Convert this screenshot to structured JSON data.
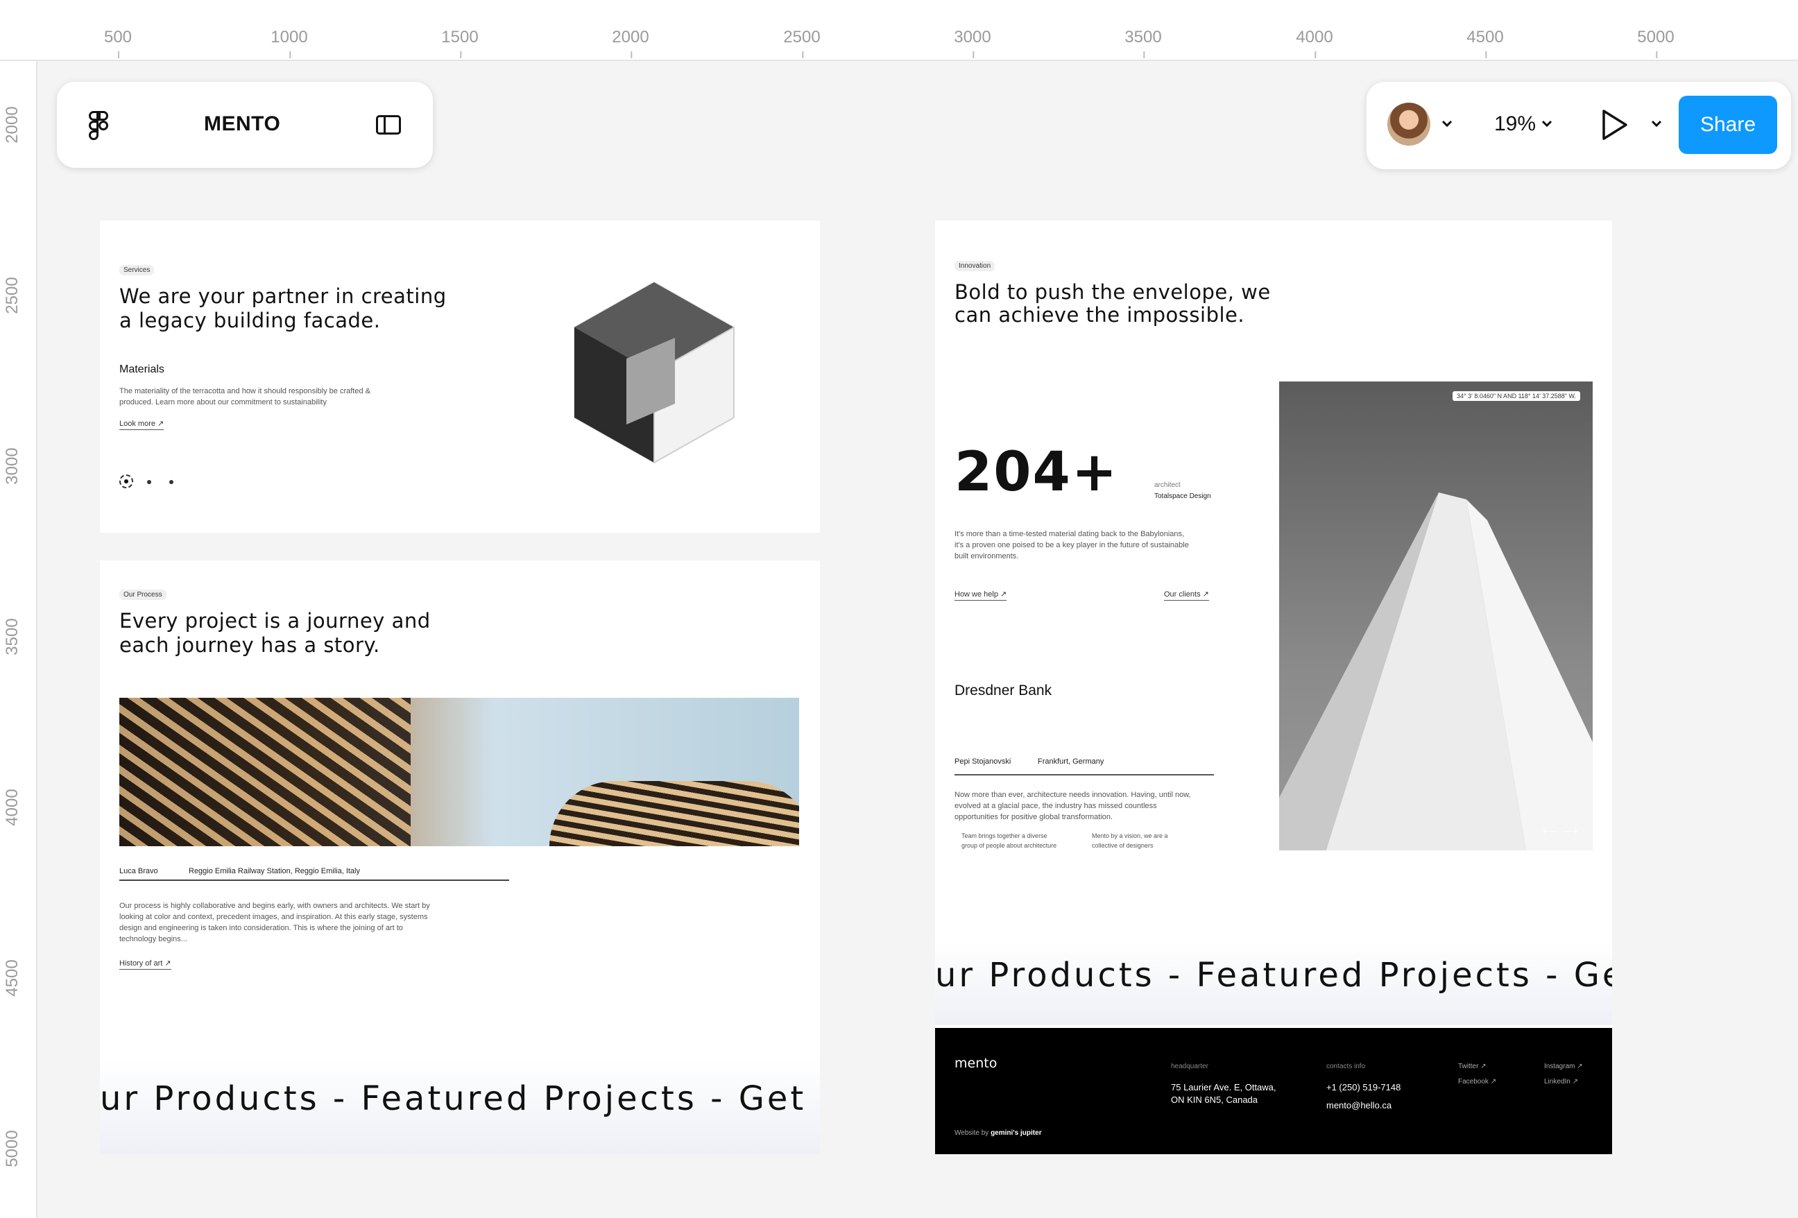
{
  "ruler": {
    "top_ticks": [
      "500",
      "1000",
      "1500",
      "2000",
      "2500",
      "3000",
      "3500",
      "4000",
      "4500",
      "5000"
    ],
    "left_ticks": [
      "2000",
      "2500",
      "3000",
      "3500",
      "4000",
      "4500",
      "5000"
    ]
  },
  "toolbar": {
    "file_name": "MENTO",
    "zoom": "19%",
    "share_label": "Share"
  },
  "frame_services": {
    "tag": "Services",
    "headline_line1": "We are your partner in creating",
    "headline_line2": "a legacy building facade.",
    "subheading": "Materials",
    "body_line1": "The materiality of the terracotta and how it should responsibly be crafted &",
    "body_line2": "produced. Learn more about our commitment to sustainability",
    "link": "Look more"
  },
  "frame_process": {
    "tag": "Our Process",
    "headline_line1": "Every project is a journey and",
    "headline_line2": "each journey has a story.",
    "credit_name": "Luca Bravo",
    "credit_place": "Reggio Emilia Railway Station, Reggio Emilia, Italy",
    "body_line1": "Our process is highly collaborative and begins early, with owners and architects. We start by",
    "body_line2": "looking at color and context, precedent images, and inspiration. At this early stage, systems",
    "body_line3": "design and engineering is taken into consideration. This is where the joining of art to",
    "body_line4": "technology begins...",
    "link": "History of art",
    "marquee": "ur Products - Featured Projects - Get In"
  },
  "frame_innovation": {
    "tag": "Innovation",
    "headline_line1": "Bold to push the envelope, we",
    "headline_line2": "can achieve the impossible.",
    "stat": "204+",
    "stat_label1": "architect",
    "stat_label2": "Totalspace Design",
    "body_line1": "It's more than a time-tested material dating back to the Babylonians,",
    "body_line2": "it's a proven one poised to be a key player in the future of sustainable",
    "body_line3": "built environments.",
    "link_help": "How we help",
    "link_clients": "Our clients",
    "coords": "34° 3' 8.0460\" N AND 118° 14' 37.2588\" W.",
    "client_title": "Dresdner Bank",
    "person": "Pepi Stojanovski",
    "place": "Frankfurt, Germany",
    "quote_line1": "Now more than ever, architecture needs innovation. Having, until now,",
    "quote_line2": "evolved at a glacial pace, the industry has missed countless",
    "quote_line3": "opportunities for positive global transformation.",
    "note1_line1": "Team brings together a diverse",
    "note1_line2": "group of people about architecture",
    "note2_line1": "Mento by a vision, we are a",
    "note2_line2": "collective of designers",
    "marquee": "ur Products - Featured Projects - Get In"
  },
  "footer": {
    "brand": "mento",
    "credit_prefix": "Website by",
    "credit_name": "gemini's jupiter",
    "hq_label": "headquarter",
    "hq_line1": "75 Laurier Ave. E, Ottawa,",
    "hq_line2": "ON KIN 6N5, Canada",
    "contact_label": "contacts info",
    "phone": "+1 (250) 519-7148",
    "email": "mento@hello.ca",
    "twitter": "Twitter ↗",
    "facebook": "Facebook ↗",
    "instagram": "Instagram ↗",
    "linkedin": "LinkedIn ↗"
  },
  "colors": {
    "accent": "#0d99ff",
    "canvas": "#f4f4f4",
    "footer_bg": "#000000"
  },
  "icons": [
    "figma-logo-icon",
    "sidebar-toggle-icon",
    "chevron-down-icon",
    "play-icon",
    "arrow-up-right-icon",
    "arrow-left-icon",
    "arrow-right-icon"
  ]
}
